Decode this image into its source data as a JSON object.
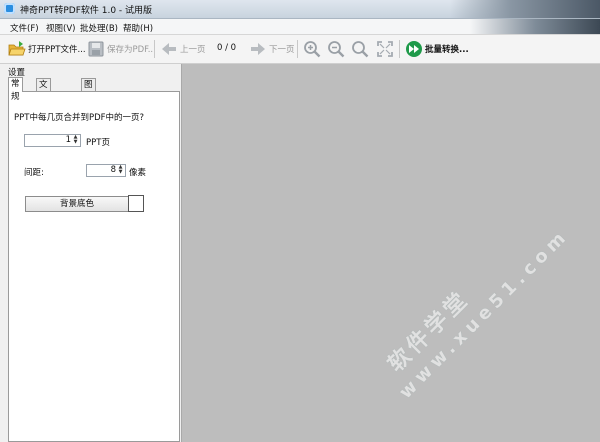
{
  "title": "神奇PPT转PDF软件 1.0 - 试用版",
  "menu": [
    "文件(F)",
    "视图(V)",
    "批处理(B)",
    "帮助(H)"
  ],
  "toolbar": {
    "open": "打开PPT文件...",
    "save": "保存为PDF...",
    "prev": "上一页",
    "page_indicator": "0 / 0",
    "next": "下一页",
    "batch": "批量转换..."
  },
  "panel": {
    "title": "设置",
    "tabs": [
      "常规",
      "文字水印",
      "图片水印"
    ],
    "merge_label": "PPT中每几页合并到PDF中的一页?",
    "pages_value": "1",
    "pages_unit": "PPT页",
    "spacing_label": "间距:",
    "spacing_value": "8",
    "spacing_unit": "像素",
    "bg_button": "背景底色",
    "bg_color": "#ffffff"
  },
  "watermark": {
    "line1": "软件学堂",
    "line2": "www.xue51.com"
  }
}
